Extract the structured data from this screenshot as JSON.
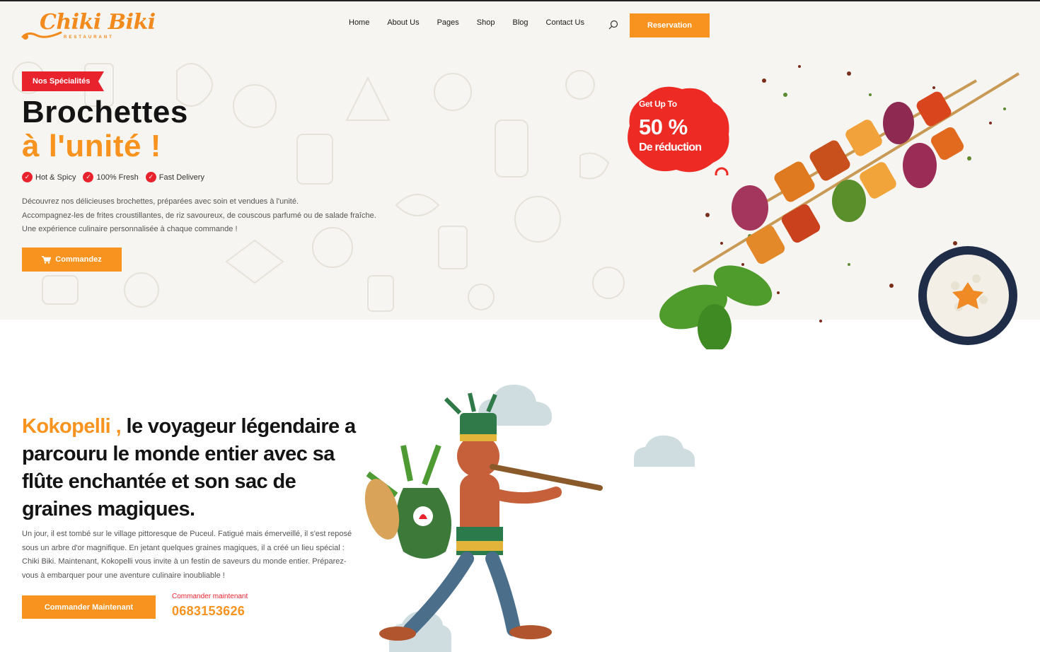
{
  "header": {
    "logo_text": "Chiki Biki",
    "logo_sub": "RESTAURANT",
    "nav": [
      "Home",
      "About Us",
      "Pages",
      "Shop",
      "Blog",
      "Contact Us"
    ],
    "reservation_label": "Reservation"
  },
  "hero": {
    "badge": "Nos Spécialités",
    "title_line1": "Brochettes",
    "title_line2": "à l'unité !",
    "features": [
      "Hot & Spicy",
      "100% Fresh",
      "Fast Delivery"
    ],
    "description": [
      "Découvrez nos délicieuses brochettes, préparées avec soin et vendues à l'unité.",
      "Accompagnez-les de frites croustillantes, de riz savoureux, de couscous parfumé ou de salade fraîche.",
      "Une expérience culinaire personnalisée à chaque commande !"
    ],
    "order_label": "Commandez",
    "promo": {
      "get_up_to": "Get Up To",
      "percent": "50 %",
      "reduction": "De réduction"
    }
  },
  "story": {
    "title_accent": "Kokopelli ,",
    "title_rest": " le voyageur légendaire a parcouru le monde entier avec sa flûte enchantée et son sac de graines magiques.",
    "description": "Un jour, il est tombé sur le village pittoresque de Puceul. Fatigué mais émerveillé, il s'est reposé sous un arbre d'or magnifique. En jetant quelques graines magiques, il a créé un lieu spécial : Chiki Biki. Maintenant, Kokopelli vous invite à un festin de saveurs du monde entier. Préparez-vous à embarquer pour une aventure culinaire inoubliable !",
    "order_label": "Commander Maintenant",
    "call_label": "Commander maintenant",
    "phone": "0683153626"
  },
  "colors": {
    "accent": "#f7931e",
    "red": "#e8232e",
    "cream": "#f7f5f1"
  }
}
